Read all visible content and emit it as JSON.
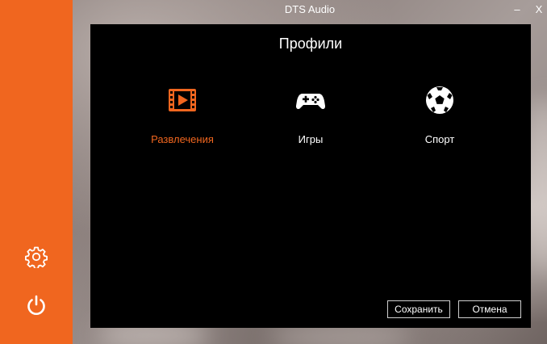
{
  "window": {
    "title": "DTS Audio",
    "minimize_label": "–",
    "close_label": "X"
  },
  "sidebar": {
    "items": [
      {
        "icon": "gear-icon"
      },
      {
        "icon": "power-icon"
      }
    ]
  },
  "main": {
    "heading": "Профили",
    "profiles": [
      {
        "label": "Развлечения",
        "icon": "film-icon",
        "selected": true
      },
      {
        "label": "Игры",
        "icon": "gamepad-icon",
        "selected": false
      },
      {
        "label": "Спорт",
        "icon": "soccer-ball-icon",
        "selected": false
      }
    ],
    "save_label": "Сохранить",
    "cancel_label": "Отмена"
  },
  "colors": {
    "accent": "#f0661f",
    "panel": "#000000",
    "text": "#ffffff"
  }
}
